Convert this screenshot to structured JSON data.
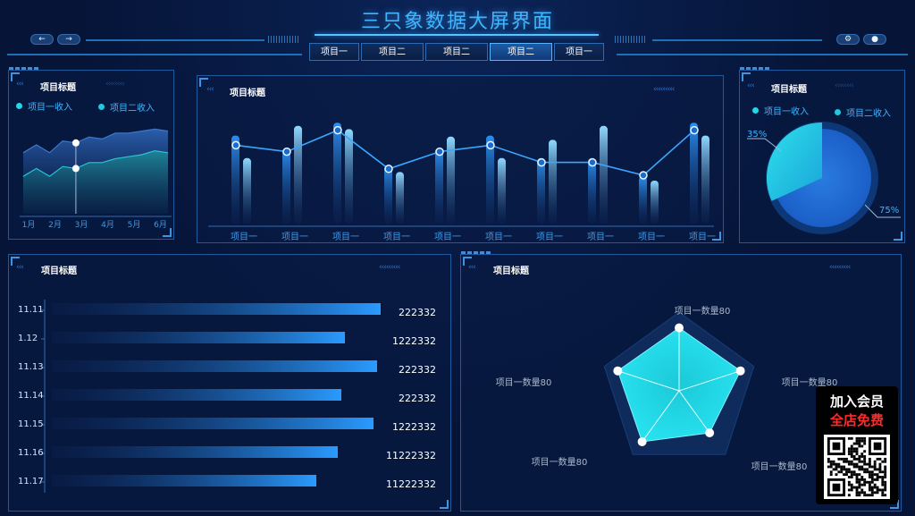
{
  "header": {
    "title": "三只象数据大屏界面",
    "tabs": [
      {
        "label": "项目一",
        "active": false
      },
      {
        "label": "项目二",
        "active": false
      },
      {
        "label": "项目二",
        "active": false
      },
      {
        "label": "项目二",
        "active": true
      },
      {
        "label": "项目一",
        "active": false
      }
    ],
    "back_icon": "arrow-left-icon",
    "forward_icon": "arrow-right-icon",
    "settings_icon": "gear-icon",
    "user_icon": "user-icon"
  },
  "colors": {
    "accent": "#3fb6ff",
    "cyan": "#24d6e8",
    "blue": "#2a8cff"
  },
  "panel_area": {
    "title": "项目标题",
    "legend": [
      "项目一收入",
      "项目二收入"
    ],
    "chart_data": {
      "type": "area",
      "categories": [
        "1月",
        "2月",
        "3月",
        "4月",
        "5月",
        "6月"
      ],
      "series": [
        {
          "name": "项目一收入",
          "values": [
            62,
            70,
            62,
            74,
            72,
            78,
            76,
            82,
            82,
            84,
            86,
            84
          ]
        },
        {
          "name": "项目二收入",
          "values": [
            38,
            46,
            38,
            48,
            46,
            52,
            52,
            56,
            58,
            60,
            64,
            62
          ]
        }
      ],
      "ylim": [
        0,
        100
      ]
    }
  },
  "panel_bars": {
    "title": "项目标题",
    "chart_data": {
      "type": "bar",
      "categories": [
        "项目一",
        "项目一",
        "项目一",
        "项目一",
        "项目一",
        "项目一",
        "项目一",
        "项目一",
        "项目一",
        "项目一"
      ],
      "series": [
        {
          "name": "bar-a",
          "values": [
            82,
            70,
            94,
            54,
            70,
            82,
            61,
            61,
            44,
            94
          ]
        },
        {
          "name": "bar-b",
          "values": [
            61,
            91,
            88,
            48,
            81,
            61,
            78,
            91,
            40,
            82
          ]
        },
        {
          "name": "line",
          "values": [
            73,
            67,
            87,
            51,
            67,
            73,
            57,
            57,
            45,
            87
          ]
        }
      ],
      "ylim": [
        0,
        100
      ]
    }
  },
  "panel_pie": {
    "title": "项目标题",
    "legend": [
      "项目一收入",
      "项目二收入"
    ],
    "chart_data": {
      "type": "pie",
      "labels": [
        "项目一收入",
        "项目二收入"
      ],
      "values": [
        35,
        75
      ],
      "value_labels": [
        "35%",
        "75%"
      ]
    }
  },
  "panel_hbars": {
    "title": "项目标题",
    "chart_data": {
      "type": "bar",
      "categories": [
        "11.11",
        "1.12",
        "11.13",
        "11.14",
        "11.15",
        "11.16",
        "11.17"
      ],
      "values": [
        92,
        82,
        91,
        81,
        90,
        80,
        74
      ],
      "value_labels": [
        "222332",
        "1222332",
        "222332",
        "222332",
        "1222332",
        "11222332",
        "11222332"
      ],
      "xlim": [
        0,
        100
      ]
    }
  },
  "panel_radar": {
    "title": "项目标题",
    "chart_data": {
      "type": "radar",
      "axes": [
        "项目一数量80",
        "项目一数量80",
        "项目一数量80",
        "项目一数量80",
        "项目一数量80"
      ],
      "values": [
        80,
        82,
        66,
        80,
        82
      ],
      "max": 100
    }
  },
  "promo": {
    "line1": "加入会员",
    "line2": "全店免费",
    "qr_icon": "qr-code-icon"
  }
}
